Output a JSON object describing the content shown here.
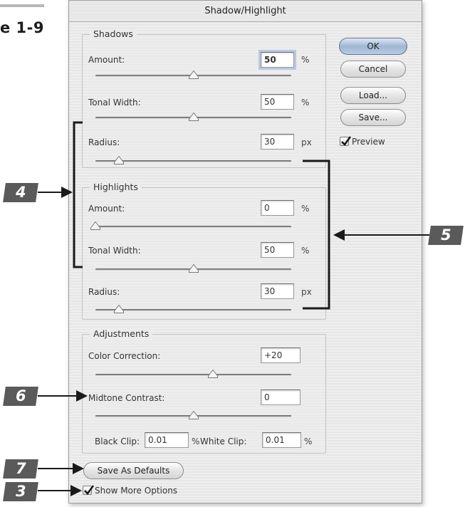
{
  "figure_label": "e 1-9",
  "dialog": {
    "title": "Shadow/Highlight",
    "buttons": {
      "ok": "OK",
      "cancel": "Cancel",
      "load": "Load...",
      "save": "Save...",
      "save_defaults": "Save As Defaults"
    },
    "preview": {
      "label": "Preview",
      "checked": true
    },
    "show_more": {
      "label": "Show More Options",
      "checked": true
    },
    "shadows": {
      "legend": "Shadows",
      "amount": {
        "label": "Amount:",
        "value": "50",
        "unit": "%",
        "slider_level": 0.5
      },
      "tonal_width": {
        "label": "Tonal Width:",
        "value": "50",
        "unit": "%",
        "slider_level": 0.5
      },
      "radius": {
        "label": "Radius:",
        "value": "30",
        "unit": "px",
        "slider_level": 0.12
      }
    },
    "highlights": {
      "legend": "Highlights",
      "amount": {
        "label": "Amount:",
        "value": "0",
        "unit": "%",
        "slider_level": 0.0
      },
      "tonal_width": {
        "label": "Tonal Width:",
        "value": "50",
        "unit": "%",
        "slider_level": 0.5
      },
      "radius": {
        "label": "Radius:",
        "value": "30",
        "unit": "px",
        "slider_level": 0.12
      }
    },
    "adjustments": {
      "legend": "Adjustments",
      "color_correction": {
        "label": "Color Correction:",
        "value": "+20",
        "slider_level": 0.6
      },
      "midtone_contrast": {
        "label": "Midtone Contrast:",
        "value": "0",
        "slider_level": 0.5
      },
      "black_clip": {
        "label": "Black Clip:",
        "value": "0.01",
        "unit": "%"
      },
      "white_clip": {
        "label": "White Clip:",
        "value": "0.01",
        "unit": "%"
      }
    }
  },
  "callouts": {
    "c4": "4",
    "c5": "5",
    "c6": "6",
    "c7": "7",
    "c3": "3"
  }
}
